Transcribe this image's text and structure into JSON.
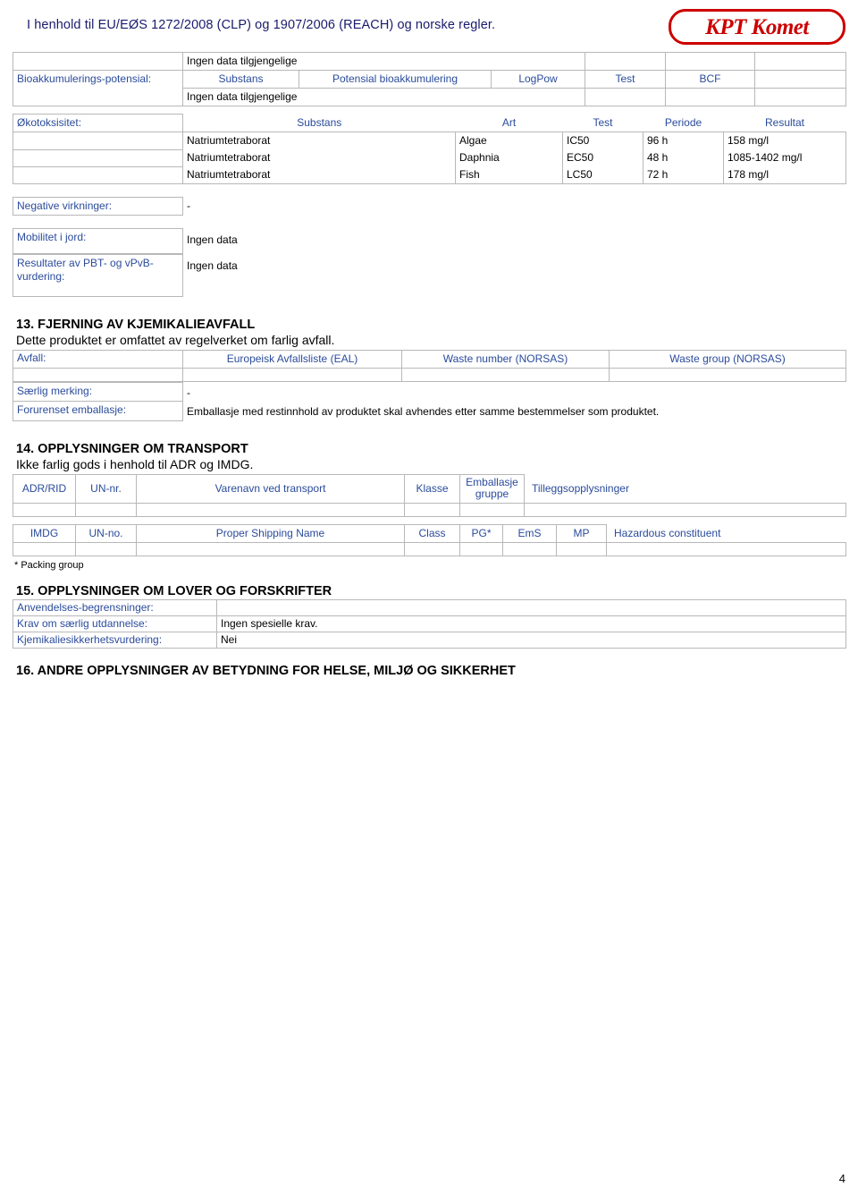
{
  "header": {
    "regulation_text": "I henhold til EU/EØS 1272/2008 (CLP) og 1907/2006 (REACH) og norske regler.",
    "logo_text": "KPT Komet"
  },
  "bioaccumulation": {
    "no_data_top": "Ingen data tilgjengelige",
    "label": "Bioakkumulerings-potensial:",
    "no_data_bottom": "Ingen data tilgjengelige",
    "columns": {
      "substance": "Substans",
      "potential": "Potensial bioakkumulering",
      "logpow": "LogPow",
      "test": "Test",
      "bcf": "BCF"
    }
  },
  "ecotoxicity": {
    "label": "Økotoksisitet:",
    "columns": {
      "substance": "Substans",
      "species": "Art",
      "test": "Test",
      "period": "Periode",
      "result": "Resultat"
    },
    "rows": [
      {
        "substance": "Natriumtetraborat",
        "species": "Algae",
        "test": "IC50",
        "period": "96 h",
        "result": "158 mg/l"
      },
      {
        "substance": "Natriumtetraborat",
        "species": "Daphnia",
        "test": "EC50",
        "period": "48 h",
        "result": "1085-1402 mg/l"
      },
      {
        "substance": "Natriumtetraborat",
        "species": "Fish",
        "test": "LC50",
        "period": "72 h",
        "result": "178 mg/l"
      }
    ]
  },
  "negative_effects": {
    "label": "Negative virkninger:",
    "value": "-"
  },
  "mobility": {
    "label": "Mobilitet i jord:",
    "value": "Ingen data"
  },
  "pbt": {
    "label": "Resultater av PBT- og vPvB-vurdering:",
    "value": "Ingen data"
  },
  "section13": {
    "title": "13. FJERNING AV KJEMIKALIEAVFALL",
    "subtitle": "Dette produktet er omfattet av regelverket om farlig avfall.",
    "waste_label": "Avfall:",
    "waste_columns": {
      "eal": "Europeisk Avfallsliste (EAL)",
      "waste_number": "Waste number (NORSAS)",
      "waste_group": "Waste group (NORSAS)"
    },
    "special_marking_label": "Særlig merking:",
    "special_marking_value": "-",
    "contaminated_label": "Forurenset emballasje:",
    "contaminated_value": "Emballasje med restinnhold av produktet skal avhendes etter samme bestemmelser som produktet."
  },
  "section14": {
    "title": "14. OPPLYSNINGER OM TRANSPORT",
    "subtitle": "Ikke farlig gods i henhold til ADR og IMDG.",
    "adr": {
      "mode": "ADR/RID",
      "un": "UN-nr.",
      "name": "Varenavn ved transport",
      "class": "Klasse",
      "packing": "Emballasje gruppe",
      "extra": "Tilleggsopplysninger"
    },
    "imdg": {
      "mode": "IMDG",
      "un": "UN-no.",
      "name": "Proper Shipping Name",
      "class": "Class",
      "pg": "PG*",
      "ems": "EmS",
      "mp": "MP",
      "hazardous": "Hazardous constituent"
    },
    "footnote": "* Packing group"
  },
  "section15": {
    "title": "15. OPPLYSNINGER OM LOVER OG FORSKRIFTER",
    "restrictions_label": "Anvendelses-begrensninger:",
    "restrictions_value": "",
    "education_label": "Krav om særlig utdannelse:",
    "education_value": "Ingen spesielle krav.",
    "assessment_label": "Kjemikaliesikkerhetsvurdering:",
    "assessment_value": "Nei"
  },
  "section16": {
    "title": "16. ANDRE OPPLYSNINGER AV BETYDNING FOR HELSE, MILJØ OG SIKKERHET"
  },
  "footer": {
    "page_number": "4"
  }
}
